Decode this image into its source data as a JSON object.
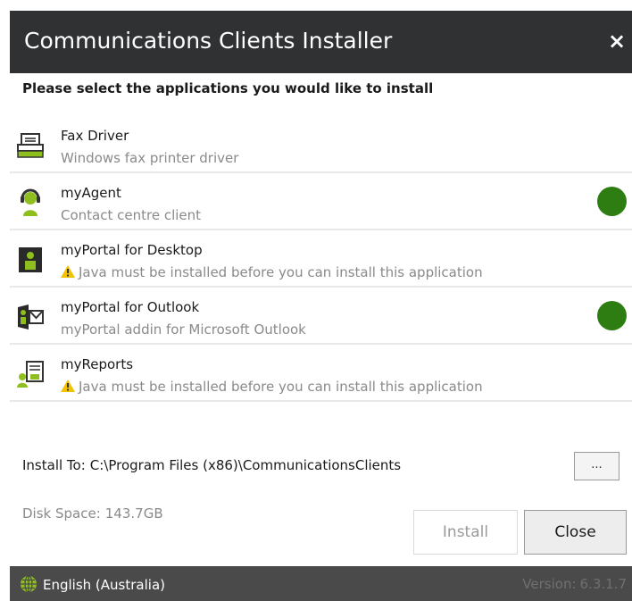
{
  "window": {
    "title": "Communications Clients Installer",
    "close_glyph": "×"
  },
  "instruction": "Please select the applications you would like to install",
  "apps": [
    {
      "name": "Fax Driver",
      "description": "Windows fax printer driver",
      "warning": false,
      "selected": false,
      "icon": "fax-printer-icon"
    },
    {
      "name": "myAgent",
      "description": "Contact centre client",
      "warning": false,
      "selected": true,
      "icon": "headset-agent-icon"
    },
    {
      "name": "myPortal for Desktop",
      "description": "Java must be installed before you can install this application",
      "warning": true,
      "selected": false,
      "icon": "portal-desktop-icon"
    },
    {
      "name": "myPortal for Outlook",
      "description": "myPortal addin for Microsoft Outlook",
      "warning": false,
      "selected": true,
      "icon": "outlook-portal-icon"
    },
    {
      "name": "myReports",
      "description": "Java must be installed before you can install this application",
      "warning": true,
      "selected": false,
      "icon": "reports-chart-icon"
    }
  ],
  "install_to": {
    "label": "Install To:",
    "path": "C:\\Program Files (x86)\\CommunicationsClients",
    "browse_label": "..."
  },
  "disk_space": {
    "label": "Disk Space:",
    "value": "143.7GB"
  },
  "buttons": {
    "install": "Install",
    "close": "Close"
  },
  "footer": {
    "language": "English (Australia)",
    "version_label": "Version:",
    "version": "6.3.1.7"
  },
  "colors": {
    "title_bar": "#2f3133",
    "footer_bar": "#4a4a4a",
    "selected_dot": "#2e7d12",
    "icon_green": "#8fbf1e",
    "warning_yellow": "#f2c200"
  }
}
